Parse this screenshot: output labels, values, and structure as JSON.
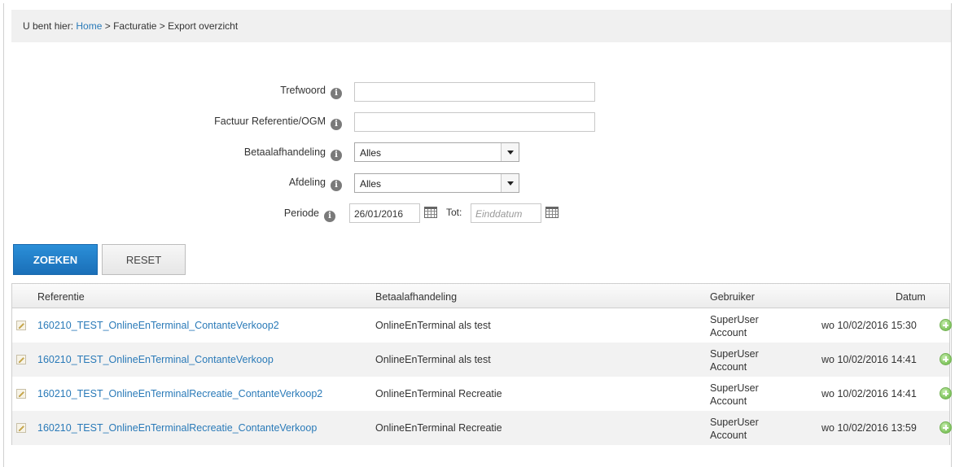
{
  "breadcrumb": {
    "prefix": "U bent hier: ",
    "home": "Home",
    "separator1": " > ",
    "section": "Facturatie",
    "separator2": " > ",
    "current": "Export overzicht"
  },
  "filters": {
    "trefwoord": {
      "label": "Trefwoord",
      "value": ""
    },
    "factuur_ref": {
      "label": "Factuur Referentie/OGM",
      "value": ""
    },
    "betaalafhandeling": {
      "label": "Betaalafhandeling",
      "selected": "Alles"
    },
    "afdeling": {
      "label": "Afdeling",
      "selected": "Alles"
    },
    "periode": {
      "label": "Periode",
      "start": "26/01/2016",
      "tot_label": "Tot:",
      "end_placeholder": "Einddatum"
    },
    "info_glyph": "i"
  },
  "buttons": {
    "search": "ZOEKEN",
    "reset": "RESET"
  },
  "table": {
    "columns": [
      "Referentie",
      "Betaalafhandeling",
      "Gebruiker",
      "Datum"
    ],
    "rows": [
      {
        "referentie": "160210_TEST_OnlineEnTerminal_ContanteVerkoop2",
        "betaalafhandeling": "OnlineEnTerminal als test",
        "gebruiker_line1": "SuperUser",
        "gebruiker_line2": "Account",
        "datum": "wo 10/02/2016 15:30"
      },
      {
        "referentie": "160210_TEST_OnlineEnTerminal_ContanteVerkoop",
        "betaalafhandeling": "OnlineEnTerminal als test",
        "gebruiker_line1": "SuperUser",
        "gebruiker_line2": "Account",
        "datum": "wo 10/02/2016 14:41"
      },
      {
        "referentie": "160210_TEST_OnlineEnTerminalRecreatie_ContanteVerkoop2",
        "betaalafhandeling": "OnlineEnTerminal Recreatie",
        "gebruiker_line1": "SuperUser",
        "gebruiker_line2": "Account",
        "datum": "wo 10/02/2016 14:41"
      },
      {
        "referentie": "160210_TEST_OnlineEnTerminalRecreatie_ContanteVerkoop",
        "betaalafhandeling": "OnlineEnTerminal Recreatie",
        "gebruiker_line1": "SuperUser",
        "gebruiker_line2": "Account",
        "datum": "wo 10/02/2016 13:59"
      }
    ]
  },
  "colors": {
    "link": "#2a7ab8",
    "primary_button": "#1a6fb8",
    "add_icon": "#7ec35c"
  }
}
